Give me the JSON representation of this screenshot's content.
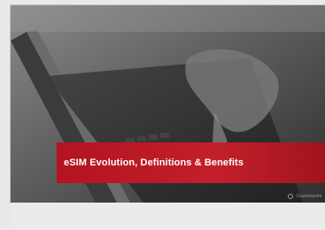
{
  "slide": {
    "title": "eSIM Evolution, Definitions & Benefits",
    "footer_text": "Counterpoint",
    "accent": "#c2202a"
  }
}
